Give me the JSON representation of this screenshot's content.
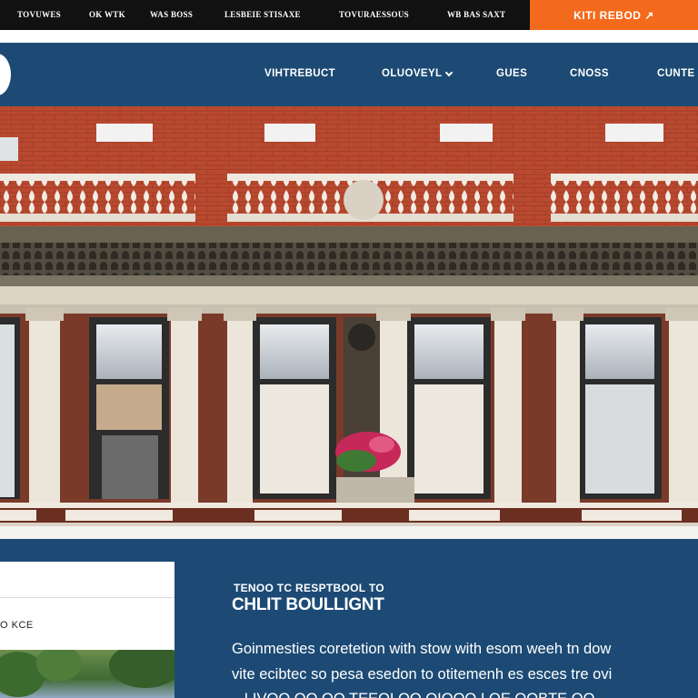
{
  "utility_bar": {
    "links": [
      "TOVUWES",
      "OK WTK",
      "WAS BOSS",
      "LESBEIE STISAXE",
      "TOVURAESSOUS",
      "WB BAS SAXT"
    ],
    "cta_label": "KITI REBOD ↗"
  },
  "nav": {
    "items": [
      "VIHTREBUCT",
      "OLUOVEYL",
      "GUES",
      "CNOSS",
      "CUNTE"
    ]
  },
  "section": {
    "kicker": "TENOO TC RESPTBOOL TO",
    "headline": "CHLIT BOULLIGNT",
    "body_lines": [
      "Goinmesties coretetion with stow with esom weeh tn dow",
      "vite ecibtec so pesa esedon to otitemenh es esces tre ovi",
      "– LIVOO OO OO TEEOI OO OIOOO I OE OOBTE OO"
    ]
  },
  "sidebar_card": {
    "label": "O KCE"
  },
  "colors": {
    "navy": "#1c4a74",
    "orange": "#f36a1d",
    "brick": "#b84a33"
  }
}
